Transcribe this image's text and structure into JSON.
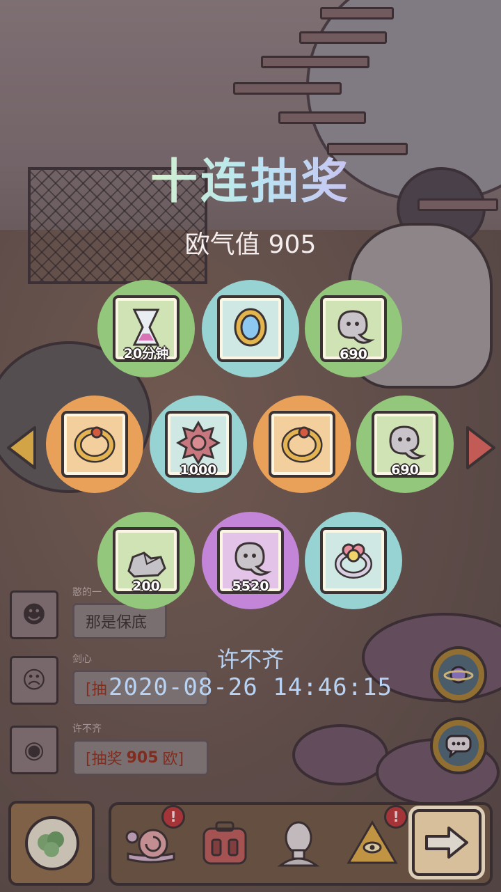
{
  "title": "十连抽奖",
  "luck": {
    "label": "欧气值",
    "value": "905"
  },
  "prizes": [
    {
      "qty": "20分钟",
      "icon": "hourglass-icon",
      "color": "#93c77b"
    },
    {
      "qty": "",
      "icon": "amulet-icon",
      "color": "#98d3d4"
    },
    {
      "qty": "690",
      "icon": "soul-icon",
      "color": "#93c77b"
    },
    {
      "qty": "",
      "icon": "ring-icon",
      "color": "#e9a15a"
    },
    {
      "qty": "1000",
      "icon": "spiked-shell-icon",
      "color": "#98d3d4"
    },
    {
      "qty": "",
      "icon": "ring-icon",
      "color": "#e9a15a"
    },
    {
      "qty": "690",
      "icon": "soul-icon",
      "color": "#93c77b"
    },
    {
      "qty": "200",
      "icon": "stone-icon",
      "color": "#93c77b"
    },
    {
      "qty": "5520",
      "icon": "soul-icon",
      "color": "#c285d8"
    },
    {
      "qty": "",
      "icon": "flower-ring-icon",
      "color": "#98d3d4"
    }
  ],
  "player": "许不齐",
  "timestamp": "2020-08-26 14:46:15",
  "chat": {
    "messages": [
      {
        "name": "憨的一",
        "text": "那是保底"
      },
      {
        "name": "剑心",
        "text": "[抽"
      },
      {
        "name": "许不齐",
        "prefix": "[抽奖",
        "value": "905",
        "suffix": "欧]"
      }
    ]
  },
  "bottom_bar": {
    "badge": "!",
    "items": [
      "home-button",
      "snail-button",
      "backpack-button",
      "bust-button",
      "pyramid-button",
      "next-button"
    ]
  }
}
